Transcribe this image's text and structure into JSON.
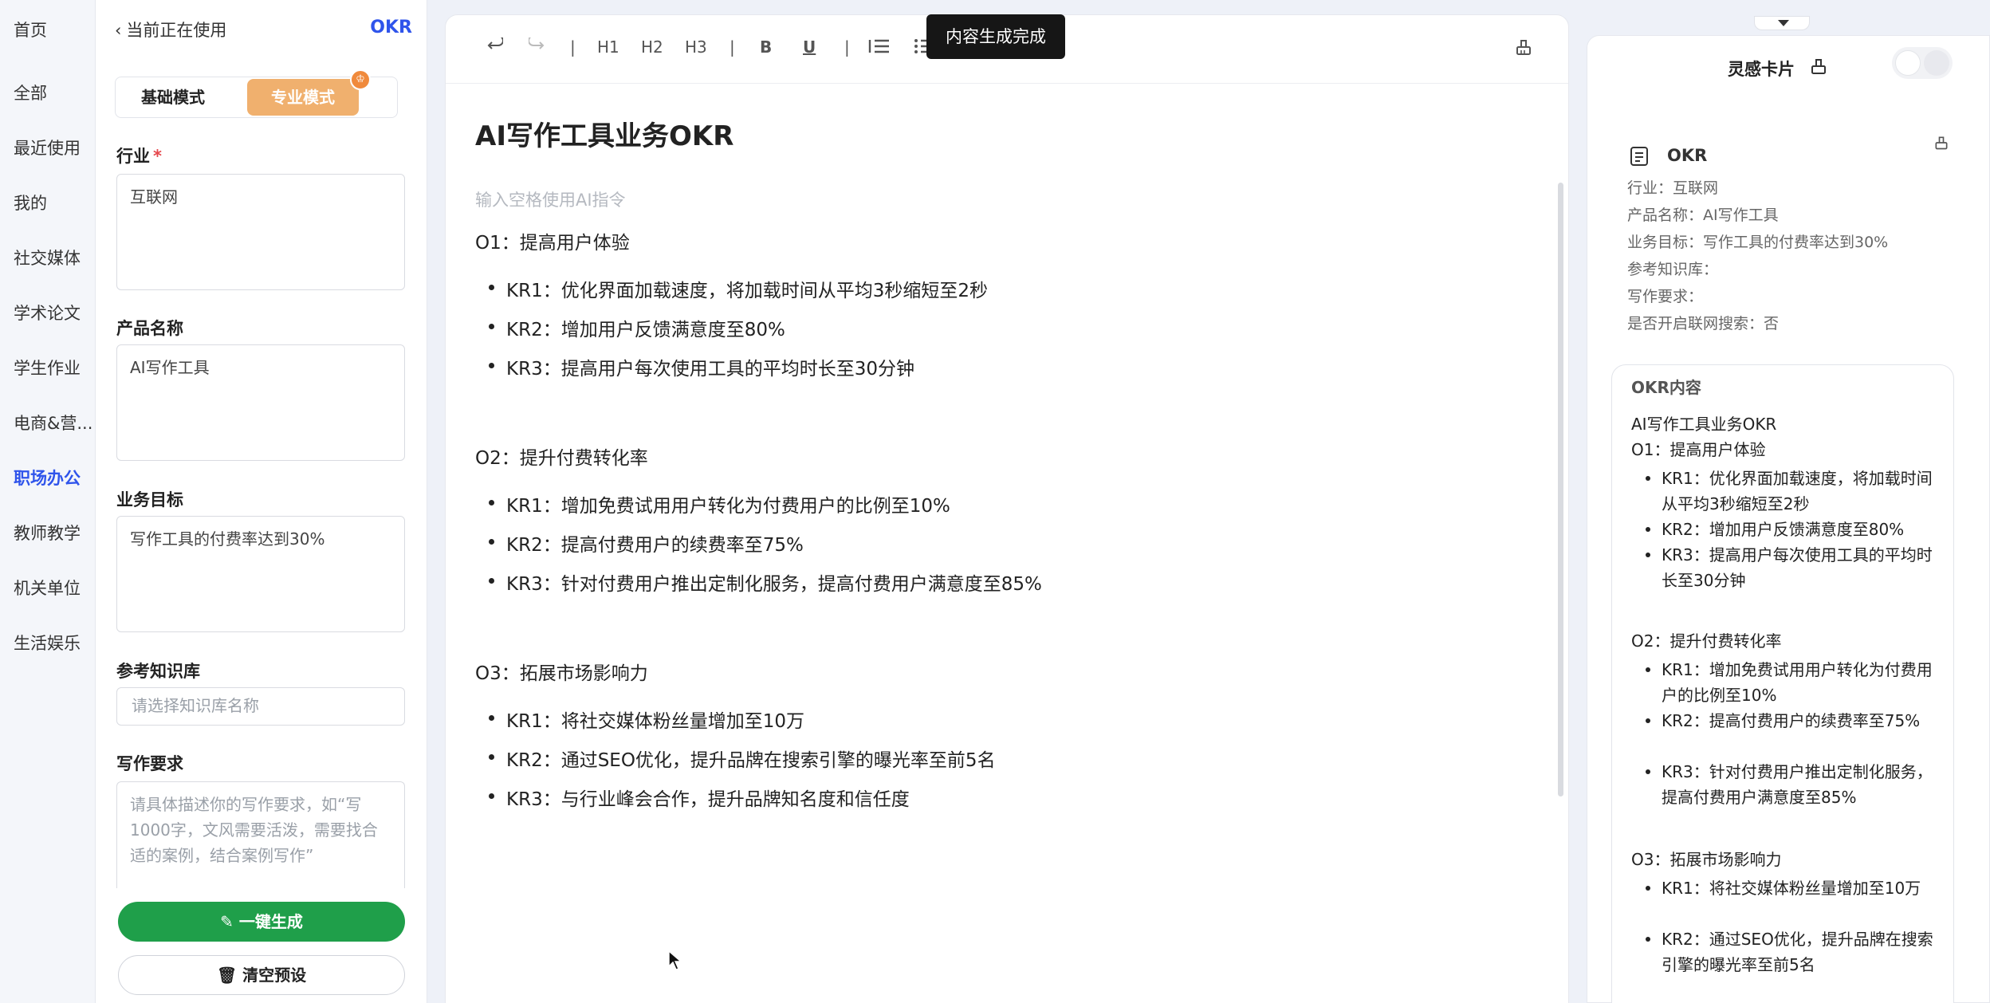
{
  "nav": {
    "items": [
      {
        "label": "首页",
        "active": false
      },
      {
        "label": "全部",
        "active": false
      },
      {
        "label": "最近使用",
        "active": false
      },
      {
        "label": "我的",
        "active": false
      },
      {
        "label": "社交媒体",
        "active": false
      },
      {
        "label": "学术论文",
        "active": false
      },
      {
        "label": "学生作业",
        "active": false
      },
      {
        "label": "电商&营...",
        "active": false
      },
      {
        "label": "职场办公",
        "active": true
      },
      {
        "label": "教师教学",
        "active": false
      },
      {
        "label": "机关单位",
        "active": false
      },
      {
        "label": "生活娱乐",
        "active": false
      }
    ]
  },
  "form": {
    "back_label": "当前正在使用",
    "template_name": "OKR",
    "mode_basic": "基础模式",
    "mode_pro": "专业模式",
    "industry_label": "行业",
    "required_mark": "*",
    "industry_value": "互联网",
    "product_label": "产品名称",
    "product_value": "AI写作工具",
    "goal_label": "业务目标",
    "goal_value": "写作工具的付费率达到30%",
    "kb_label": "参考知识库",
    "kb_placeholder": "请选择知识库名称",
    "req_label": "写作要求",
    "req_placeholder": "请具体描述你的写作要求，如“写1000字，文风需要活泼，需要找合适的案例，结合案例写作”",
    "generate_label": "一键生成",
    "clear_label": "清空预设"
  },
  "toolbar": {
    "h1": "H1",
    "h2": "H2",
    "h3": "H3",
    "bold": "B",
    "underline": "U",
    "sep": "|",
    "toast": "内容生成完成"
  },
  "doc": {
    "title": "AI写作工具业务OKR",
    "hint": "输入空格使用AI指令",
    "objectives": [
      {
        "title": "O1：提高用户体验",
        "krs": [
          "KR1：优化界面加载速度，将加载时间从平均3秒缩短至2秒",
          "KR2：增加用户反馈满意度至80%",
          "KR3：提高用户每次使用工具的平均时长至30分钟"
        ]
      },
      {
        "title": "O2：提升付费转化率",
        "krs": [
          "KR1：增加免费试用用户转化为付费用户的比例至10%",
          "KR2：提高付费用户的续费率至75%",
          "KR3：针对付费用户推出定制化服务，提高付费用户满意度至85%"
        ]
      },
      {
        "title": "O3：拓展市场影响力",
        "krs": [
          "KR1：将社交媒体粉丝量增加至10万",
          "KR2：通过SEO优化，提升品牌在搜索引擎的曝光率至前5名",
          "KR3：与行业峰会合作，提升品牌知名度和信任度"
        ]
      }
    ]
  },
  "inspiration": {
    "title": "灵感卡片",
    "meta_title": "OKR",
    "meta_lines": [
      "行业：互联网",
      "产品名称：AI写作工具",
      "业务目标：写作工具的付费率达到30%",
      "参考知识库：",
      "写作要求：",
      "是否开启联网搜索：否"
    ],
    "card_header": "OKR内容",
    "card_title": "AI写作工具业务OKR",
    "card_o1": "O1：提高用户体验",
    "card_o1_krs": [
      "KR1：优化界面加载速度，将加载时间从平均3秒缩短至2秒",
      "KR2：增加用户反馈满意度至80%",
      "KR3：提高用户每次使用工具的平均时长至30分钟"
    ],
    "card_o2": "O2：提升付费转化率",
    "card_o2_krs": [
      "KR1：增加免费试用用户转化为付费用户的比例至10%",
      "KR2：提高付费用户的续费率至75%",
      "KR3：针对付费用户推出定制化服务，提高付费用户满意度至85%"
    ],
    "card_o3": "O3：拓展市场影响力",
    "card_o3_krs": [
      "KR1：将社交媒体粉丝量增加至10万",
      "KR2：通过SEO优化，提升品牌在搜索引擎的曝光率至前5名"
    ]
  },
  "colors": {
    "accent": "#2f54eb",
    "generate": "#1f9f4a",
    "pro_mode": "#f0b06e",
    "required": "#e5484d"
  }
}
